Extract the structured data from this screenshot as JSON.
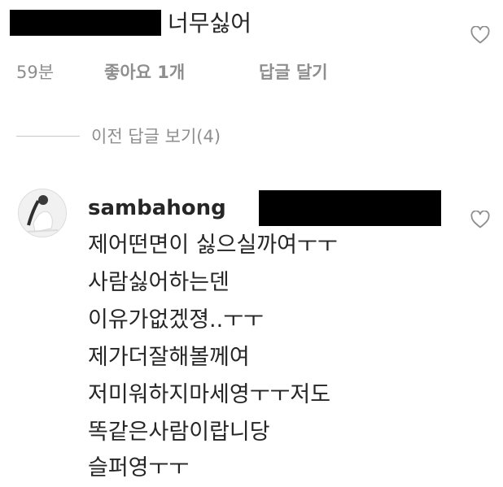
{
  "top_comment": {
    "text": "너무싫어",
    "time": "59분",
    "likes": "좋아요 1개",
    "reply_button": "답글 달기"
  },
  "replies": {
    "view_label": "이전 답글 보기(4)"
  },
  "reply": {
    "username": "sambahong",
    "lines": [
      "제어떤면이 싫으실까여ㅜㅜ",
      "사람싫어하는덴",
      "이유가없겠졍..ㅜㅜ",
      "제가더잘해볼께여",
      "저미워하지마세영ㅜㅜ저도",
      "똑같은사람이랍니당",
      "슬퍼영ㅜㅜ"
    ]
  },
  "icons": {
    "like": "heart-outline-icon",
    "avatar": "profile-avatar"
  }
}
